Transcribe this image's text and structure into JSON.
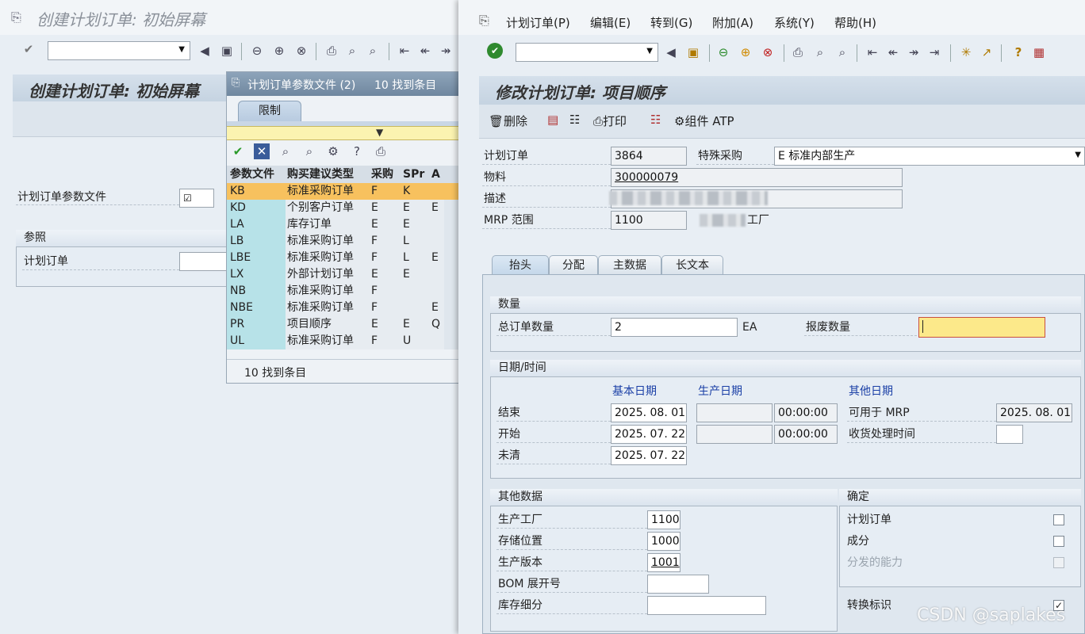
{
  "left": {
    "title": "创建计划订单: 初始屏幕",
    "page_title": "创建计划订单: 初始屏幕",
    "profile_label": "计划订单参数文件",
    "ref_group": "参照",
    "ref_order_label": "计划订单"
  },
  "popup": {
    "title": "计划订单参数文件 (2)",
    "count": "10 找到条目",
    "tab": "限制",
    "columns": [
      "参数文件",
      "购买建议类型",
      "采购",
      "SPr",
      "A"
    ],
    "rows": [
      [
        "KB",
        "标准采购订单",
        "F",
        "K",
        ""
      ],
      [
        "KD",
        "个别客户订单",
        "E",
        "E",
        "E"
      ],
      [
        "LA",
        "库存订单",
        "E",
        "E",
        ""
      ],
      [
        "LB",
        "标准采购订单",
        "F",
        "L",
        ""
      ],
      [
        "LBE",
        "标准采购订单",
        "F",
        "L",
        "E"
      ],
      [
        "LX",
        "外部计划订单",
        "E",
        "E",
        ""
      ],
      [
        "NB",
        "标准采购订单",
        "F",
        "",
        ""
      ],
      [
        "NBE",
        "标准采购订单",
        "F",
        "",
        "E"
      ],
      [
        "PR",
        "项目顺序",
        "E",
        "E",
        "Q"
      ],
      [
        "UL",
        "标准采购订单",
        "F",
        "U",
        ""
      ]
    ],
    "footer": "10 找到条目"
  },
  "right": {
    "menu": [
      "计划订单(P)",
      "编辑(E)",
      "转到(G)",
      "附加(A)",
      "系统(Y)",
      "帮助(H)"
    ],
    "page_title": "修改计划订单: 项目顺序",
    "actions": {
      "delete": "删除",
      "print": "打印",
      "atp": "组件 ATP"
    },
    "header": {
      "order_label": "计划订单",
      "order_value": "3864",
      "special_label": "特殊采购",
      "special_value": "E 标准内部生产",
      "material_label": "物料",
      "material_value": "300000079",
      "desc_label": "描述",
      "mrp_label": "MRP 范围",
      "mrp_value": "1100",
      "mrp_suffix": "工厂"
    },
    "tabs": [
      "抬头",
      "分配",
      "主数据",
      "长文本"
    ],
    "qty": {
      "group": "数量",
      "total_label": "总订单数量",
      "total_value": "2",
      "unit": "EA",
      "scrap_label": "报废数量"
    },
    "dates": {
      "group": "日期/时间",
      "basic_hdr": "基本日期",
      "prod_hdr": "生产日期",
      "other_hdr": "其他日期",
      "end_label": "结束",
      "end_value": "2025. 08. 01",
      "end_time": "00:00:00",
      "start_label": "开始",
      "start_value": "2025. 07. 22",
      "start_time": "00:00:00",
      "open_label": "未清",
      "open_value": "2025. 07. 22",
      "mrp_avail_label": "可用于 MRP",
      "mrp_avail_value": "2025. 08. 01",
      "gr_label": "收货处理时间"
    },
    "other": {
      "group": "其他数据",
      "plant_label": "生产工厂",
      "plant_value": "1100",
      "sloc_label": "存储位置",
      "sloc_value": "1000",
      "version_label": "生产版本",
      "version_value": "1001",
      "bom_label": "BOM 展开号",
      "stock_label": "库存细分"
    },
    "confirm": {
      "group": "确定",
      "planned_label": "计划订单",
      "component_label": "成分",
      "capacity_label": "分发的能力",
      "convert_label": "转换标识"
    }
  },
  "watermark": "CSDN @saplakes"
}
